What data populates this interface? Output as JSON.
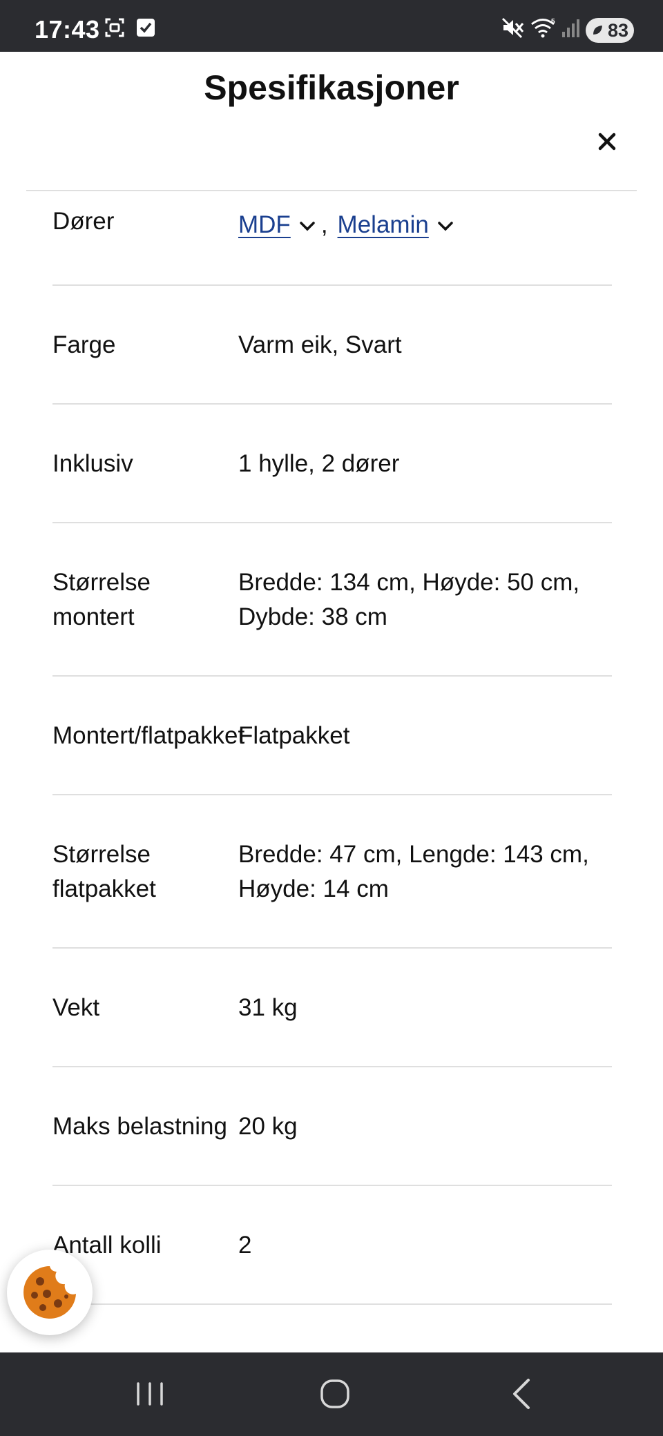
{
  "status_bar": {
    "time": "17:43",
    "battery": "83",
    "icons": [
      "screenshot-icon",
      "checkbox-icon",
      "mute-icon",
      "wifi-icon",
      "signal-icon",
      "battery-icon"
    ]
  },
  "modal": {
    "title": "Spesifikasjoner",
    "close_icon": "close-icon"
  },
  "specs": [
    {
      "label": "Dører",
      "links": [
        "MDF",
        "Melamin"
      ],
      "separator": ","
    },
    {
      "label": "Farge",
      "value": "Varm eik, Svart"
    },
    {
      "label": "Inklusiv",
      "value": "1 hylle, 2 dører"
    },
    {
      "label_lines": [
        "Størrelse",
        "montert"
      ],
      "value_lines": [
        "Bredde: 134 cm, Høyde: 50 cm,",
        "Dybde: 38 cm"
      ]
    },
    {
      "label": "Montert/flatpakket",
      "value": "Flatpakket"
    },
    {
      "label_lines": [
        "Størrelse",
        "flatpakket"
      ],
      "value_lines": [
        "Bredde: 47 cm, Lengde: 143 cm,",
        "Høyde: 14 cm"
      ]
    },
    {
      "label": "Vekt",
      "value": "31 kg"
    },
    {
      "label": "Maks belastning",
      "value": "20 kg"
    },
    {
      "label": "Antall kolli",
      "value": "2"
    }
  ],
  "cookie": {
    "icon": "cookie-icon"
  },
  "nav_bar": {
    "icons": [
      "recent-apps-icon",
      "home-icon",
      "back-icon"
    ]
  },
  "colors": {
    "status_bar": "#2b2c30",
    "link": "#1a3f8f",
    "divider": "#dfdfdf",
    "cookie": "#e07c1a"
  }
}
